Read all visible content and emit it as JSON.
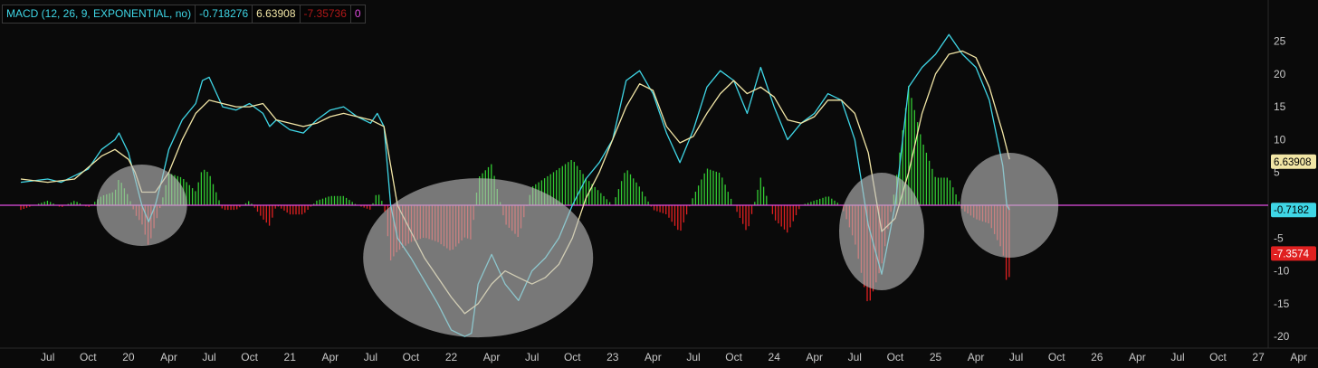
{
  "legend": {
    "study": "MACD (12, 26, 9, EXPONENTIAL, no)",
    "value": "-0.718276",
    "avg": "6.63908",
    "diff": "-7.35736",
    "zero": "0"
  },
  "colors": {
    "value_line": "#3fd6e6",
    "avg_line": "#f2e6a6",
    "zero_line": "#e04de0",
    "hist_up": "#33cc33",
    "hist_down": "#e02020",
    "highlight": "#bdbdbd"
  },
  "chart_data": {
    "type": "line",
    "title": "",
    "ylim": [
      -21,
      29
    ],
    "yticks": [
      25,
      20,
      15,
      10,
      5,
      -5,
      -10,
      -15,
      -20
    ],
    "xticks": [
      "Jul",
      "Oct",
      "20",
      "Apr",
      "Jul",
      "Oct",
      "21",
      "Apr",
      "Jul",
      "Oct",
      "22",
      "Apr",
      "Jul",
      "Oct",
      "23",
      "Apr",
      "Jul",
      "Oct",
      "24",
      "Apr",
      "Jul",
      "Oct",
      "25",
      "Apr",
      "Jul",
      "Oct",
      "26",
      "Apr",
      "Jul",
      "Oct",
      "27",
      "Apr"
    ],
    "x_start_month": 5,
    "x_start_year": 2019,
    "series": [
      {
        "key": "value",
        "data": [
          [
            0,
            3.5
          ],
          [
            2,
            4
          ],
          [
            3,
            3.5
          ],
          [
            5,
            5.5
          ],
          [
            6,
            8.5
          ],
          [
            7,
            10
          ],
          [
            7.3,
            11
          ],
          [
            8,
            8
          ],
          [
            8.5,
            4
          ],
          [
            9,
            0
          ],
          [
            9.5,
            -2.5
          ],
          [
            10,
            0
          ],
          [
            10.5,
            4
          ],
          [
            11,
            8.5
          ],
          [
            12,
            13
          ],
          [
            13,
            15.5
          ],
          [
            13.5,
            19
          ],
          [
            14,
            19.5
          ],
          [
            15,
            15
          ],
          [
            16,
            14.5
          ],
          [
            17,
            15.5
          ],
          [
            18,
            14
          ],
          [
            18.5,
            12
          ],
          [
            19,
            13
          ],
          [
            20,
            11.5
          ],
          [
            21,
            11
          ],
          [
            22,
            13
          ],
          [
            23,
            14.5
          ],
          [
            24,
            15
          ],
          [
            25,
            13.5
          ],
          [
            26,
            12.5
          ],
          [
            26.5,
            14
          ],
          [
            27,
            12
          ],
          [
            27.5,
            0
          ],
          [
            28,
            -5
          ],
          [
            29,
            -8
          ],
          [
            30,
            -11.5
          ],
          [
            31,
            -15
          ],
          [
            32,
            -19
          ],
          [
            33,
            -20
          ],
          [
            33.5,
            -19.5
          ],
          [
            34,
            -12
          ],
          [
            35,
            -7.5
          ],
          [
            36,
            -12
          ],
          [
            37,
            -14.5
          ],
          [
            38,
            -10
          ],
          [
            39,
            -8
          ],
          [
            40,
            -5
          ],
          [
            41,
            0
          ],
          [
            42,
            4
          ],
          [
            43,
            6.5
          ],
          [
            44,
            10
          ],
          [
            45,
            19
          ],
          [
            46,
            20.5
          ],
          [
            47,
            17
          ],
          [
            48,
            11
          ],
          [
            49,
            6.5
          ],
          [
            50,
            11.5
          ],
          [
            51,
            18
          ],
          [
            52,
            20.5
          ],
          [
            53,
            19
          ],
          [
            54,
            14
          ],
          [
            55,
            21
          ],
          [
            56,
            15
          ],
          [
            57,
            10
          ],
          [
            58,
            12.5
          ],
          [
            59,
            14
          ],
          [
            60,
            17
          ],
          [
            61,
            16
          ],
          [
            62,
            10
          ],
          [
            63,
            -3
          ],
          [
            64,
            -10.5
          ],
          [
            65,
            0
          ],
          [
            66,
            18
          ],
          [
            67,
            21
          ],
          [
            68,
            23
          ],
          [
            69,
            26
          ],
          [
            70,
            23
          ],
          [
            71,
            21
          ],
          [
            72,
            16
          ],
          [
            73,
            6
          ],
          [
            73.3,
            0
          ],
          [
            73.5,
            -0.72
          ]
        ]
      },
      {
        "key": "avg",
        "data": [
          [
            0,
            4
          ],
          [
            2,
            3.5
          ],
          [
            4,
            4
          ],
          [
            6,
            7.5
          ],
          [
            7,
            8.5
          ],
          [
            8,
            7
          ],
          [
            8.5,
            5
          ],
          [
            9,
            2
          ],
          [
            10,
            2
          ],
          [
            11,
            5
          ],
          [
            12,
            10
          ],
          [
            13,
            14
          ],
          [
            14,
            16
          ],
          [
            15,
            15.5
          ],
          [
            16,
            15
          ],
          [
            17,
            15
          ],
          [
            18,
            15.5
          ],
          [
            19,
            13
          ],
          [
            20,
            12.5
          ],
          [
            21,
            12
          ],
          [
            22,
            12.5
          ],
          [
            23,
            13.5
          ],
          [
            24,
            14
          ],
          [
            25,
            13.5
          ],
          [
            26,
            13
          ],
          [
            27,
            12
          ],
          [
            28,
            0
          ],
          [
            29,
            -4
          ],
          [
            30,
            -8
          ],
          [
            31,
            -11
          ],
          [
            32,
            -14
          ],
          [
            33,
            -16.5
          ],
          [
            34,
            -15
          ],
          [
            35,
            -12
          ],
          [
            36,
            -10
          ],
          [
            37,
            -11
          ],
          [
            38,
            -12
          ],
          [
            39,
            -11
          ],
          [
            40,
            -9
          ],
          [
            41,
            -5
          ],
          [
            42,
            1
          ],
          [
            43,
            5
          ],
          [
            44,
            10
          ],
          [
            45,
            15
          ],
          [
            46,
            18.5
          ],
          [
            47,
            17.5
          ],
          [
            48,
            12
          ],
          [
            49,
            9.5
          ],
          [
            50,
            10.5
          ],
          [
            51,
            14
          ],
          [
            52,
            17
          ],
          [
            53,
            19
          ],
          [
            54,
            17
          ],
          [
            55,
            18
          ],
          [
            56,
            16.5
          ],
          [
            57,
            13
          ],
          [
            58,
            12.5
          ],
          [
            59,
            13.5
          ],
          [
            60,
            16
          ],
          [
            61,
            16
          ],
          [
            62,
            14
          ],
          [
            63,
            8
          ],
          [
            64,
            -4
          ],
          [
            65,
            -2
          ],
          [
            66,
            5
          ],
          [
            67,
            14
          ],
          [
            68,
            20
          ],
          [
            69,
            23
          ],
          [
            70,
            23.5
          ],
          [
            71,
            22.5
          ],
          [
            72,
            18
          ],
          [
            73,
            11
          ],
          [
            73.5,
            7
          ]
        ]
      }
    ],
    "highlights": [
      {
        "month": 9,
        "value": 0
      },
      {
        "month": 34,
        "value": -8
      },
      {
        "month": 64,
        "value": -4
      },
      {
        "month": 73.5,
        "value": 0
      }
    ],
    "last_value_labels": [
      {
        "text": "6.63908",
        "value": 6.63908,
        "color_key": "avg_line",
        "text_color": "#000"
      },
      {
        "text": "-0.7182",
        "value": -0.7182,
        "color_key": "value_line",
        "text_color": "#000"
      },
      {
        "text": "-7.3574",
        "value": -7.3574,
        "color_key": "hist_down",
        "text_color": "#fff"
      }
    ]
  }
}
